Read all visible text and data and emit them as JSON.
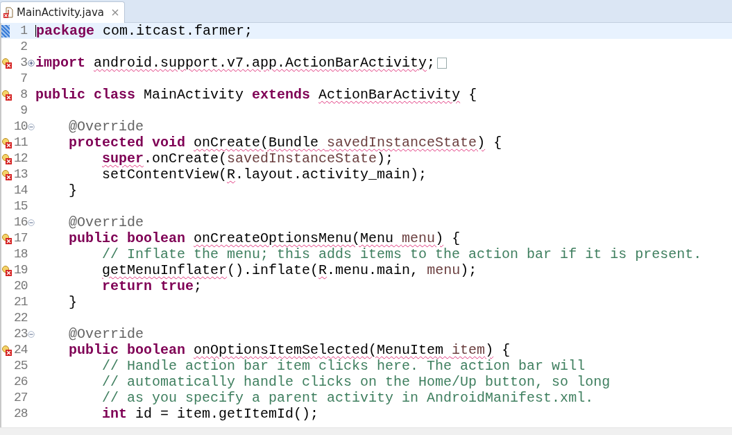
{
  "tab": {
    "label": "MainActivity.java",
    "selected": true
  },
  "lines": [
    {
      "number": "1",
      "current": true,
      "error": false,
      "tokens": [
        {
          "kind": "keyword",
          "text": "package",
          "error": false
        },
        {
          "kind": "plain",
          "text": " com.itcast.farmer;",
          "error": false
        }
      ]
    },
    {
      "number": "2",
      "current": false,
      "error": false
    },
    {
      "number": "3",
      "current": false,
      "error": true,
      "fold": {
        "expanded": false
      },
      "tokens": [
        {
          "kind": "keyword",
          "text": "import ",
          "error": false
        },
        {
          "kind": "plain",
          "text": "android.support.v7.app.ActionBarActivity",
          "error": true
        },
        {
          "kind": "plain",
          "text": ";",
          "error": false
        }
      ]
    },
    {
      "number": "7",
      "current": false,
      "error": false
    },
    {
      "number": "8",
      "current": false,
      "error": true,
      "tokens": [
        {
          "kind": "keyword",
          "text": "public class",
          "error": false
        },
        {
          "kind": "plain",
          "text": " MainActivity ",
          "error": false
        },
        {
          "kind": "keyword",
          "text": "extends ",
          "error": false
        },
        {
          "kind": "plain",
          "text": "ActionBarActivity",
          "error": true
        },
        {
          "kind": "plain",
          "text": " {",
          "error": false
        }
      ]
    },
    {
      "number": "9",
      "current": false,
      "error": false
    },
    {
      "number": "10",
      "current": false,
      "error": false,
      "fold": {
        "expanded": true
      },
      "tokens": [
        {
          "kind": "annotation",
          "text": "    @Override",
          "error": false
        }
      ]
    },
    {
      "number": "11",
      "current": false,
      "error": true,
      "tokens": [
        {
          "kind": "keyword",
          "text": "    protected void ",
          "error": false
        },
        {
          "kind": "plain",
          "text": "onCreate(Bundle ",
          "error": true
        },
        {
          "kind": "param",
          "text": "savedInstanceState",
          "error": true
        },
        {
          "kind": "plain",
          "text": ")",
          "error": true
        },
        {
          "kind": "plain",
          "text": " {",
          "error": false
        }
      ]
    },
    {
      "number": "12",
      "current": false,
      "error": true,
      "tokens": [
        {
          "kind": "keyword",
          "text": "        super",
          "error": true
        },
        {
          "kind": "plain",
          "text": ".onCreate(",
          "error": false
        },
        {
          "kind": "param",
          "text": "savedInstanceState",
          "error": false
        },
        {
          "kind": "plain",
          "text": ");",
          "error": false
        }
      ]
    },
    {
      "number": "13",
      "current": false,
      "error": true,
      "tokens": [
        {
          "kind": "plain",
          "text": "        setContentView(",
          "error": false
        },
        {
          "kind": "plain",
          "text": "R",
          "error": true
        },
        {
          "kind": "plain",
          "text": ".layout.activity_main);",
          "error": false
        }
      ]
    },
    {
      "number": "14",
      "current": false,
      "error": false,
      "tokens": [
        {
          "kind": "plain",
          "text": "    }",
          "error": false
        }
      ]
    },
    {
      "number": "15",
      "current": false,
      "error": false
    },
    {
      "number": "16",
      "current": false,
      "error": false,
      "fold": {
        "expanded": true
      },
      "tokens": [
        {
          "kind": "annotation",
          "text": "    @Override",
          "error": false
        }
      ]
    },
    {
      "number": "17",
      "current": false,
      "error": true,
      "tokens": [
        {
          "kind": "keyword",
          "text": "    public boolean ",
          "error": false
        },
        {
          "kind": "plain",
          "text": "onCreateOptionsMenu(Menu ",
          "error": true
        },
        {
          "kind": "param",
          "text": "menu",
          "error": true
        },
        {
          "kind": "plain",
          "text": ")",
          "error": true
        },
        {
          "kind": "plain",
          "text": " {",
          "error": false
        }
      ]
    },
    {
      "number": "18",
      "current": false,
      "error": false,
      "tokens": [
        {
          "kind": "comment",
          "text": "        // Inflate the menu; this adds items to the action bar if it is present.",
          "error": false
        }
      ]
    },
    {
      "number": "19",
      "current": false,
      "error": true,
      "tokens": [
        {
          "kind": "plain",
          "text": "        getMenuInflater",
          "error": true
        },
        {
          "kind": "plain",
          "text": "().inflate(",
          "error": false
        },
        {
          "kind": "plain",
          "text": "R",
          "error": true
        },
        {
          "kind": "plain",
          "text": ".menu.main, ",
          "error": false
        },
        {
          "kind": "param",
          "text": "menu",
          "error": false
        },
        {
          "kind": "plain",
          "text": ");",
          "error": false
        }
      ]
    },
    {
      "number": "20",
      "current": false,
      "error": false,
      "tokens": [
        {
          "kind": "keyword",
          "text": "        return true",
          "error": false
        },
        {
          "kind": "plain",
          "text": ";",
          "error": false
        }
      ]
    },
    {
      "number": "21",
      "current": false,
      "error": false,
      "tokens": [
        {
          "kind": "plain",
          "text": "    }",
          "error": false
        }
      ]
    },
    {
      "number": "22",
      "current": false,
      "error": false
    },
    {
      "number": "23",
      "current": false,
      "error": false,
      "fold": {
        "expanded": true
      },
      "tokens": [
        {
          "kind": "annotation",
          "text": "    @Override",
          "error": false
        }
      ]
    },
    {
      "number": "24",
      "current": false,
      "error": true,
      "tokens": [
        {
          "kind": "keyword",
          "text": "    public boolean ",
          "error": false
        },
        {
          "kind": "plain",
          "text": "onOptionsItemSelected(MenuItem ",
          "error": true
        },
        {
          "kind": "param",
          "text": "item",
          "error": true
        },
        {
          "kind": "plain",
          "text": ")",
          "error": true
        },
        {
          "kind": "plain",
          "text": " {",
          "error": false
        }
      ]
    },
    {
      "number": "25",
      "current": false,
      "error": false,
      "tokens": [
        {
          "kind": "comment",
          "text": "        // Handle action bar item clicks here. The action bar will",
          "error": false
        }
      ]
    },
    {
      "number": "26",
      "current": false,
      "error": false,
      "tokens": [
        {
          "kind": "comment",
          "text": "        // automatically handle clicks on the Home/Up button, so long",
          "error": false
        }
      ]
    },
    {
      "number": "27",
      "current": false,
      "error": false,
      "tokens": [
        {
          "kind": "comment",
          "text": "        // as you specify a parent activity in AndroidManifest.xml.",
          "error": false
        }
      ]
    },
    {
      "number": "28",
      "current": false,
      "error": false,
      "tokens": [
        {
          "kind": "keyword",
          "text": "        int",
          "error": false
        },
        {
          "kind": "plain",
          "text": " id = item.getItemId();",
          "error": false
        }
      ]
    }
  ]
}
